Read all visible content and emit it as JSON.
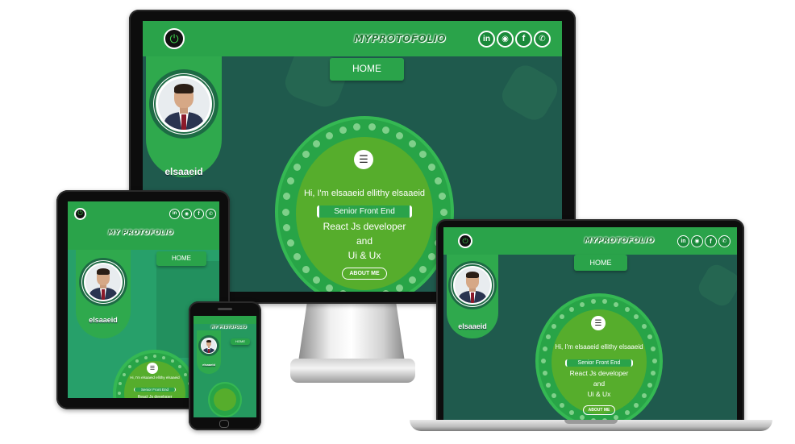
{
  "site": {
    "brand": "MYPROTOFOLIO",
    "brand_spaced": "MY PROTOFOLIO",
    "home_label": "HOME",
    "user_name": "elsaaeid",
    "greeting": "Hi, I'm elsaaeid ellithy elsaaeid",
    "role": "Senior Front End",
    "line2": "React Js developer",
    "line3": "and",
    "line4": "Ui & Ux",
    "about_label": "ABOUT ME",
    "menu_glyph": "☰",
    "socials": [
      {
        "icon": "linkedin-icon",
        "glyph": "in"
      },
      {
        "icon": "github-icon",
        "glyph": "◉"
      },
      {
        "icon": "facebook-icon",
        "glyph": "f"
      },
      {
        "icon": "whatsapp-icon",
        "glyph": "✆"
      }
    ],
    "power_glyph": "⏻"
  },
  "colors": {
    "navbar": "#2aa34a",
    "background": "#1f5a4d",
    "hero_ring": "#28a447",
    "hero_inner": "#56ad2c",
    "accent": "#35b853"
  }
}
